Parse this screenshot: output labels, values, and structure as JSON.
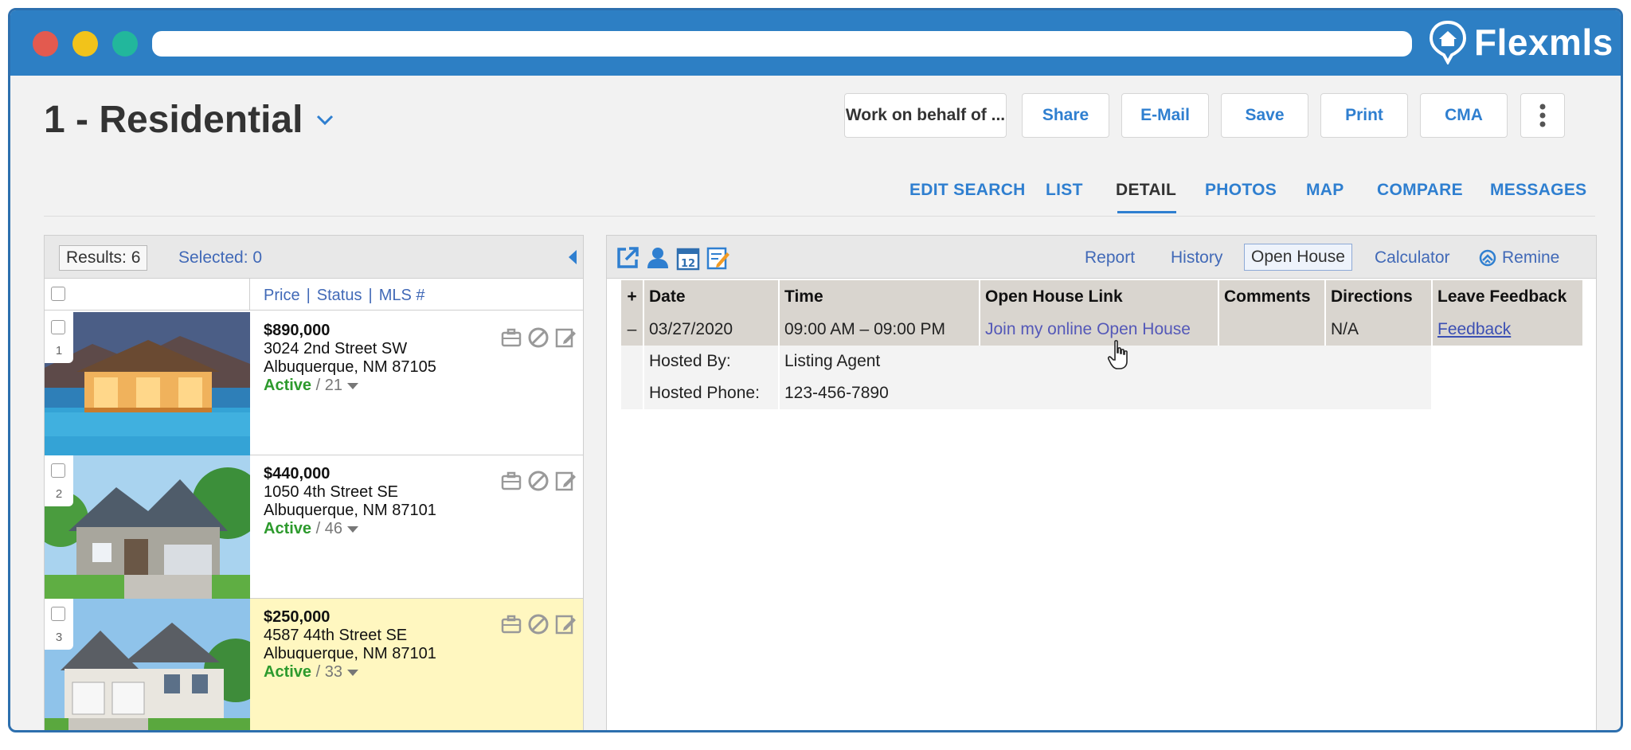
{
  "browser": {
    "brand": "Flexmls"
  },
  "header": {
    "title": "1 - Residential",
    "buttons": [
      "Work on behalf of ...",
      "Share",
      "E-Mail",
      "Save",
      "Print",
      "CMA"
    ]
  },
  "tabs": [
    "EDIT SEARCH",
    "LIST",
    "DETAIL",
    "PHOTOS",
    "MAP",
    "COMPARE",
    "MESSAGES"
  ],
  "results_panel": {
    "results_label": "Results: 6",
    "selected_label": "Selected: 0",
    "column_headers": [
      "Price",
      "Status",
      "MLS #"
    ],
    "separator": "|",
    "listings": [
      {
        "num": "1",
        "price": "$890,000",
        "street": "3024 2nd Street SW",
        "city": "Albuquerque, NM 87105",
        "status": "Active",
        "dom": " / 21"
      },
      {
        "num": "2",
        "price": "$440,000",
        "street": "1050 4th Street SE",
        "city": "Albuquerque, NM 87101",
        "status": "Active",
        "dom": " / 46"
      },
      {
        "num": "3",
        "price": "$250,000",
        "street": "4587 44th Street SE",
        "city": "Albuquerque, NM 87101",
        "status": "Active",
        "dom": " / 33"
      }
    ]
  },
  "detail_panel": {
    "nav": {
      "report": "Report",
      "history": "History",
      "open_house": "Open House",
      "calculator": "Calculator",
      "remine": "Remine"
    },
    "table": {
      "headers": {
        "expand": "+",
        "date": "Date",
        "time": "Time",
        "link": "Open House Link",
        "comments": "Comments",
        "directions": "Directions",
        "feedback": "Leave Feedback"
      },
      "row": {
        "collapse": "–",
        "date": "03/27/2020",
        "time": "09:00 AM – 09:00 PM",
        "link": "Join my online Open House",
        "comments": "",
        "directions": "N/A",
        "feedback": "Feedback"
      },
      "hosted_by_label": "Hosted By:",
      "hosted_by_value": "Listing Agent",
      "hosted_phone_label": "Hosted Phone:",
      "hosted_phone_value": "123-456-7890"
    }
  },
  "colors": {
    "brand_blue": "#2d7fc4",
    "link_blue": "#2f7fd0",
    "status_green": "#2d9a2d",
    "highlight_row": "#fff7c0"
  }
}
